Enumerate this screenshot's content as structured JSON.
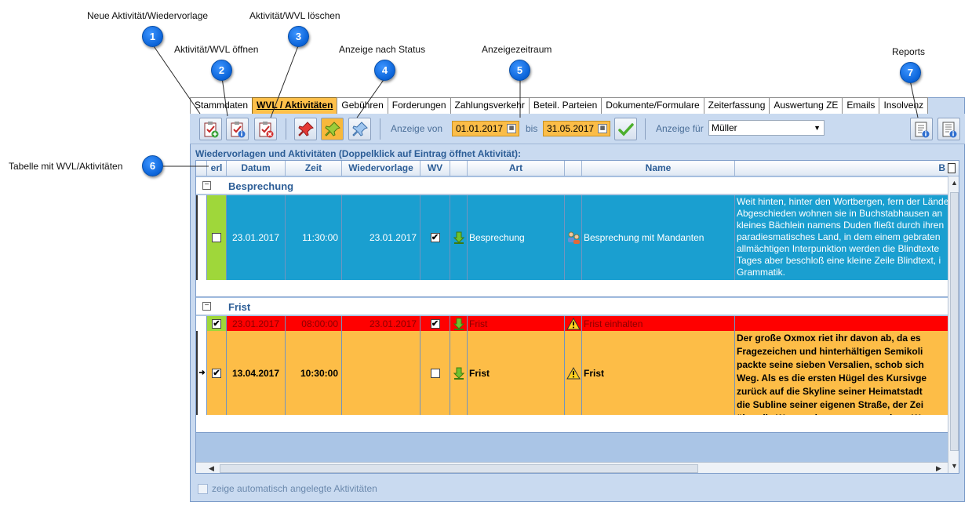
{
  "callouts": [
    {
      "num": "1",
      "label": "Neue Aktivität/Wiedervorlage"
    },
    {
      "num": "2",
      "label": "Aktivität/WVL öffnen"
    },
    {
      "num": "3",
      "label": "Aktivität/WVL löschen"
    },
    {
      "num": "4",
      "label": "Anzeige nach Status"
    },
    {
      "num": "5",
      "label": "Anzeigezeitraum"
    },
    {
      "num": "6",
      "label": "Tabelle mit WVL/Aktivitäten"
    },
    {
      "num": "7",
      "label": "Reports"
    }
  ],
  "tabs": [
    "Stammdaten",
    "WVL / Aktivitäten",
    "Gebühren",
    "Forderungen",
    "Zahlungsverkehr",
    "Beteil. Parteien",
    "Dokumente/Formulare",
    "Zeiterfassung",
    "Auswertung ZE",
    "Emails",
    "Insolvenz"
  ],
  "active_tab": "WVL / Aktivitäten",
  "toolbar": {
    "anzeige_von_label": "Anzeige von",
    "date_from": "01.01.2017",
    "bis_label": "bis",
    "date_to": "31.05.2017",
    "anzeige_fuer_label": "Anzeige für",
    "anzeige_fuer_value": "Müller"
  },
  "section_title": "Wiedervorlagen und Aktivitäten (Doppelklick auf Eintrag öffnet Aktivität):",
  "columns": [
    "erl",
    "Datum",
    "Zeit",
    "Wiedervorlage",
    "WV",
    "Art",
    "Name",
    "B"
  ],
  "groups": [
    {
      "name": "Besprechung",
      "rows": [
        {
          "erl": true,
          "datum": "23.01.2017",
          "zeit": "11:30:00",
          "wiedervorlage": "23.01.2017",
          "wv": true,
          "art": "Besprechung",
          "name": "Besprechung mit Mandanten",
          "text": "Weit hinten, hinter den Wortbergen, fern der Länder\nAbgeschieden wohnen sie in Buchstabhausen an\nkleines Bächlein namens Duden fließt durch ihren\nparadiesmatisches Land, in dem einem gebraten\nallmächtigen Interpunktion werden die Blindtexte\nTages aber beschloß eine kleine Zeile Blindtext, i\nGrammatik."
        }
      ]
    },
    {
      "name": "Frist",
      "rows": [
        {
          "erl": true,
          "datum": "23.01.2017",
          "zeit": "08:00:00",
          "wiedervorlage": "23.01.2017",
          "wv": true,
          "art": "Frist",
          "name": "Frist einhalten",
          "text": ""
        },
        {
          "erl": true,
          "datum": "13.04.2017",
          "zeit": "10:30:00",
          "wiedervorlage": "",
          "wv": false,
          "art": "Frist",
          "name": "Frist",
          "text": "Der große Oxmox riet ihr davon ab, da es\nFragezeichen und hinterhältigen Semikoli\npackte seine sieben Versalien, schob sich\nWeg. Als es die ersten Hügel des Kursivge\nzurück auf die Skyline seiner Heimatstadt\ndie Subline seiner eigenen Straße, der Zei\nüber die Wange, dann setzte es seinen We"
        }
      ]
    }
  ],
  "footer_checkbox_label": "zeige automatisch angelegte Aktivitäten",
  "colors": {
    "accent": "#ffc04a",
    "row_blue": "#1a9fd0",
    "row_green": "#9fd73a",
    "row_red": "#ff0000",
    "row_orange": "#fdbd47"
  }
}
